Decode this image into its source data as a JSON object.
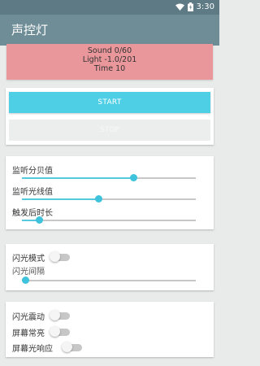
{
  "status_bar": {
    "time": "3:30",
    "icons": [
      "wifi-icon",
      "battery-icon"
    ]
  },
  "app_bar": {
    "title": "声控灯"
  },
  "info": {
    "sound": "Sound 0/60",
    "light": "Light -1.0/201",
    "time": "Time 10"
  },
  "buttons": {
    "start_label": "START",
    "stop_label": "STOP"
  },
  "sliders": [
    {
      "label": "监听分贝值",
      "value": 0.64
    },
    {
      "label": "监听光线值",
      "value": 0.44
    },
    {
      "label": "触发后时长",
      "value": 0.1
    }
  ],
  "flash": {
    "mode_label": "闪光模式",
    "mode_on": false,
    "interval_label": "闪光间隔",
    "interval_value": 0.02
  },
  "options": [
    {
      "label": "闪光震动",
      "on": false
    },
    {
      "label": "屏幕常亮",
      "on": false
    },
    {
      "label": "屏幕光响应",
      "on": false
    }
  ],
  "colors": {
    "accent": "#4fcfe6",
    "app_bar": "#6f8d97",
    "info_bg": "#ea979b"
  }
}
